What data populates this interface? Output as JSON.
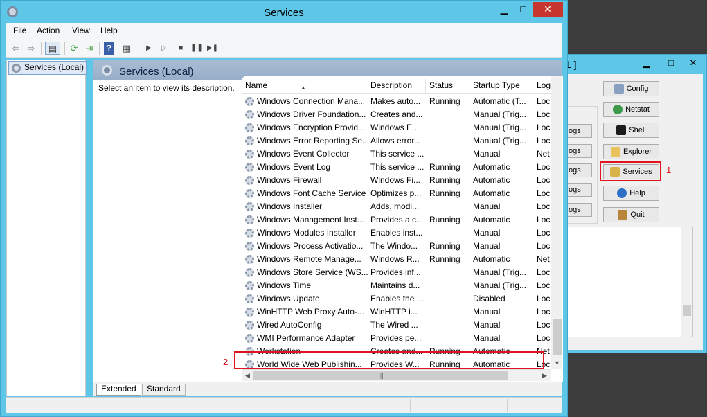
{
  "main_window": {
    "title": "Services",
    "controls": {
      "minimize": "▁",
      "maximize": "□",
      "close": "✕"
    }
  },
  "menu": [
    "File",
    "Action",
    "View",
    "Help"
  ],
  "toolbar_icons": [
    "back-arrow-icon",
    "forward-arrow-icon",
    "show-hide-console-tree-icon",
    "refresh-icon",
    "export-list-icon",
    "help-icon",
    "properties-icon",
    "start-service-icon",
    "start-service-icon",
    "stop-service-icon",
    "pause-service-icon",
    "restart-service-icon"
  ],
  "tree": {
    "item": "Services (Local)"
  },
  "content": {
    "header": "Services (Local)",
    "description_hint": "Select an item to view its description."
  },
  "columns": [
    "Name",
    "Description",
    "Status",
    "Startup Type",
    "Log"
  ],
  "services": [
    {
      "name": "Windows Connection Mana...",
      "desc": "Makes auto...",
      "status": "Running",
      "startup": "Automatic (T...",
      "log": "Loc"
    },
    {
      "name": "Windows Driver Foundation...",
      "desc": "Creates and...",
      "status": "",
      "startup": "Manual (Trig...",
      "log": "Loc"
    },
    {
      "name": "Windows Encryption Provid...",
      "desc": "Windows E...",
      "status": "",
      "startup": "Manual (Trig...",
      "log": "Loc"
    },
    {
      "name": "Windows Error Reporting Se...",
      "desc": "Allows error...",
      "status": "",
      "startup": "Manual (Trig...",
      "log": "Loc"
    },
    {
      "name": "Windows Event Collector",
      "desc": "This service ...",
      "status": "",
      "startup": "Manual",
      "log": "Net"
    },
    {
      "name": "Windows Event Log",
      "desc": "This service ...",
      "status": "Running",
      "startup": "Automatic",
      "log": "Loc"
    },
    {
      "name": "Windows Firewall",
      "desc": "Windows Fi...",
      "status": "Running",
      "startup": "Automatic",
      "log": "Loc"
    },
    {
      "name": "Windows Font Cache Service",
      "desc": "Optimizes p...",
      "status": "Running",
      "startup": "Automatic",
      "log": "Loc"
    },
    {
      "name": "Windows Installer",
      "desc": "Adds, modi...",
      "status": "",
      "startup": "Manual",
      "log": "Loc"
    },
    {
      "name": "Windows Management Inst...",
      "desc": "Provides a c...",
      "status": "Running",
      "startup": "Automatic",
      "log": "Loc"
    },
    {
      "name": "Windows Modules Installer",
      "desc": "Enables inst...",
      "status": "",
      "startup": "Manual",
      "log": "Loc"
    },
    {
      "name": "Windows Process Activatio...",
      "desc": "The Windo...",
      "status": "Running",
      "startup": "Manual",
      "log": "Loc"
    },
    {
      "name": "Windows Remote Manage...",
      "desc": "Windows R...",
      "status": "Running",
      "startup": "Automatic",
      "log": "Net"
    },
    {
      "name": "Windows Store Service (WS...",
      "desc": "Provides inf...",
      "status": "",
      "startup": "Manual (Trig...",
      "log": "Loc"
    },
    {
      "name": "Windows Time",
      "desc": "Maintains d...",
      "status": "",
      "startup": "Manual (Trig...",
      "log": "Loc"
    },
    {
      "name": "Windows Update",
      "desc": "Enables the ...",
      "status": "",
      "startup": "Disabled",
      "log": "Loc"
    },
    {
      "name": "WinHTTP Web Proxy Auto-...",
      "desc": "WinHTTP i...",
      "status": "",
      "startup": "Manual",
      "log": "Loc"
    },
    {
      "name": "Wired AutoConfig",
      "desc": "The Wired ...",
      "status": "",
      "startup": "Manual",
      "log": "Loc"
    },
    {
      "name": "WMI Performance Adapter",
      "desc": "Provides pe...",
      "status": "",
      "startup": "Manual",
      "log": "Loc"
    },
    {
      "name": "Workstation",
      "desc": "Creates and...",
      "status": "Running",
      "startup": "Automatic",
      "log": "Net"
    },
    {
      "name": "World Wide Web Publishin...",
      "desc": "Provides W...",
      "status": "Running",
      "startup": "Automatic",
      "log": "Loc"
    }
  ],
  "tabs": [
    "Extended",
    "Standard"
  ],
  "tool_window": {
    "title_fragment": "1 ]",
    "controls": {
      "minimize": "▁",
      "maximize": "□",
      "close": "✕"
    },
    "buttons": [
      {
        "label": "Config",
        "icon": "wrench-icon"
      },
      {
        "label": "Netstat",
        "icon": "globe-icon"
      },
      {
        "label": "Shell",
        "icon": "terminal-icon"
      },
      {
        "label": "Explorer",
        "icon": "folder-icon"
      },
      {
        "label": "Services",
        "icon": "services-icon"
      },
      {
        "label": "Help",
        "icon": "help-icon"
      },
      {
        "label": "Quit",
        "icon": "door-icon"
      }
    ],
    "logs_buttons": [
      "ogs",
      "ogs",
      "ogs",
      "ogs",
      "ogs"
    ]
  },
  "annotations": {
    "one": "1",
    "two": "2"
  },
  "colors": {
    "titlebar": "#5ec7e8",
    "close": "#c7372f",
    "highlight": "#e0141e"
  }
}
